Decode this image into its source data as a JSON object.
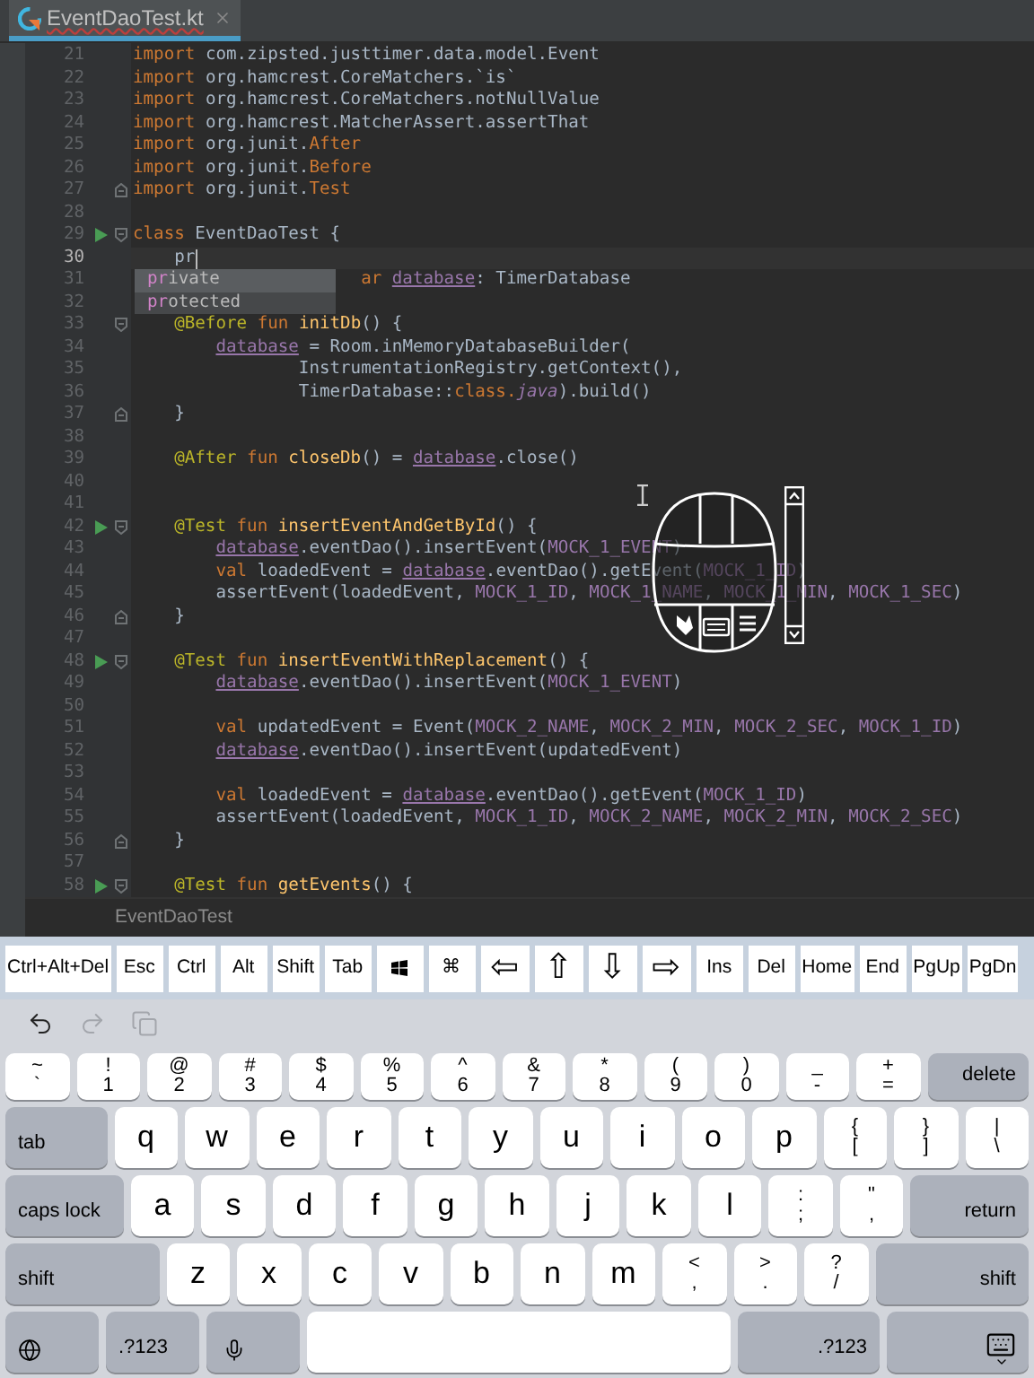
{
  "tab": {
    "label": "EventDaoTest.kt",
    "selected": true,
    "has_error": true
  },
  "editor": {
    "lines": [
      {
        "number": "21",
        "current": false,
        "tokens": [
          {
            "kind": "keyword",
            "text": "import "
          },
          {
            "kind": "plain",
            "text": "com.zipsted.justtimer.data.model.Event"
          }
        ]
      },
      {
        "number": "22",
        "current": false,
        "tokens": [
          {
            "kind": "keyword",
            "text": "import "
          },
          {
            "kind": "plain",
            "text": "org.hamcrest.CoreMatchers.`is`"
          }
        ]
      },
      {
        "number": "23",
        "current": false,
        "tokens": [
          {
            "kind": "keyword",
            "text": "import "
          },
          {
            "kind": "plain",
            "text": "org.hamcrest.CoreMatchers.notNullValue"
          }
        ]
      },
      {
        "number": "24",
        "current": false,
        "tokens": [
          {
            "kind": "keyword",
            "text": "import "
          },
          {
            "kind": "plain",
            "text": "org.hamcrest.MatcherAssert.assertThat"
          }
        ]
      },
      {
        "number": "25",
        "current": false,
        "tokens": [
          {
            "kind": "keyword",
            "text": "import "
          },
          {
            "kind": "plain",
            "text": "org.junit."
          },
          {
            "kind": "keyword",
            "text": "After"
          }
        ]
      },
      {
        "number": "26",
        "current": false,
        "tokens": [
          {
            "kind": "keyword",
            "text": "import "
          },
          {
            "kind": "plain",
            "text": "org.junit."
          },
          {
            "kind": "keyword",
            "text": "Before"
          }
        ]
      },
      {
        "number": "27",
        "current": false,
        "gutter": [
          {
            "kind": "fold_end"
          }
        ],
        "tokens": [
          {
            "kind": "keyword",
            "text": "import "
          },
          {
            "kind": "plain",
            "text": "org.junit."
          },
          {
            "kind": "keyword",
            "text": "Test"
          }
        ]
      },
      {
        "number": "28",
        "current": false
      },
      {
        "number": "29",
        "current": false,
        "gutter": [
          {
            "kind": "run"
          },
          {
            "kind": "fold_start"
          }
        ],
        "tokens": [
          {
            "kind": "keyword",
            "text": "class "
          },
          {
            "kind": "plain",
            "text": "EventDaoTest {"
          }
        ]
      },
      {
        "number": "30",
        "current": true,
        "tokens": [
          {
            "kind": "plain",
            "text": "    pr"
          }
        ]
      },
      {
        "number": "31",
        "current": false,
        "tokens": [
          {
            "kind": "keyword",
            "text": "                      ar "
          },
          {
            "kind": "property",
            "text": "database"
          },
          {
            "kind": "plain",
            "text": ": TimerDatabase"
          }
        ]
      },
      {
        "number": "32",
        "current": false
      },
      {
        "number": "33",
        "current": false,
        "gutter": [
          {
            "kind": "fold_start"
          }
        ],
        "tokens": [
          {
            "kind": "annotation",
            "text": "    @Before "
          },
          {
            "kind": "keyword",
            "text": "fun "
          },
          {
            "kind": "function",
            "text": "initDb"
          },
          {
            "kind": "plain",
            "text": "() {"
          }
        ]
      },
      {
        "number": "34",
        "current": false,
        "tokens": [
          {
            "kind": "property",
            "text": "        database"
          },
          {
            "kind": "plain",
            "text": " = Room.inMemoryDatabaseBuilder("
          }
        ]
      },
      {
        "number": "35",
        "current": false,
        "tokens": [
          {
            "kind": "plain",
            "text": "                InstrumentationRegistry.getContext(),"
          }
        ]
      },
      {
        "number": "36",
        "current": false,
        "tokens": [
          {
            "kind": "plain",
            "text": "                TimerDatabase::"
          },
          {
            "kind": "keyword",
            "text": "class."
          },
          {
            "kind": "italic",
            "text": "java"
          },
          {
            "kind": "plain",
            "text": ").build()"
          }
        ]
      },
      {
        "number": "37",
        "current": false,
        "gutter": [
          {
            "kind": "fold_end"
          }
        ],
        "tokens": [
          {
            "kind": "plain",
            "text": "    }"
          }
        ]
      },
      {
        "number": "38",
        "current": false
      },
      {
        "number": "39",
        "current": false,
        "tokens": [
          {
            "kind": "annotation",
            "text": "    @After "
          },
          {
            "kind": "keyword",
            "text": "fun "
          },
          {
            "kind": "function",
            "text": "closeDb"
          },
          {
            "kind": "plain",
            "text": "() = "
          },
          {
            "kind": "property",
            "text": "database"
          },
          {
            "kind": "plain",
            "text": ".close()"
          }
        ]
      },
      {
        "number": "40",
        "current": false
      },
      {
        "number": "41",
        "current": false
      },
      {
        "number": "42",
        "current": false,
        "gutter": [
          {
            "kind": "run"
          },
          {
            "kind": "fold_start"
          }
        ],
        "tokens": [
          {
            "kind": "annotation",
            "text": "    @Test "
          },
          {
            "kind": "keyword",
            "text": "fun "
          },
          {
            "kind": "function",
            "text": "insertEventAndGetById"
          },
          {
            "kind": "plain",
            "text": "() {"
          }
        ]
      },
      {
        "number": "43",
        "current": false,
        "tokens": [
          {
            "kind": "property",
            "text": "        database"
          },
          {
            "kind": "plain",
            "text": ".eventDao().insertEvent("
          },
          {
            "kind": "constant",
            "text": "MOCK_1_EVENT"
          },
          {
            "kind": "plain",
            "text": ")"
          }
        ]
      },
      {
        "number": "44",
        "current": false,
        "tokens": [
          {
            "kind": "keyword",
            "text": "        val "
          },
          {
            "kind": "plain",
            "text": "loadedEvent = "
          },
          {
            "kind": "property",
            "text": "database"
          },
          {
            "kind": "plain",
            "text": ".eventDao().getEvent("
          },
          {
            "kind": "constant",
            "text": "MOCK_1_ID"
          },
          {
            "kind": "plain",
            "text": ")"
          }
        ]
      },
      {
        "number": "45",
        "current": false,
        "tokens": [
          {
            "kind": "plain",
            "text": "        assertEvent(loadedEvent, "
          },
          {
            "kind": "constant",
            "text": "MOCK_1_ID"
          },
          {
            "kind": "plain",
            "text": ", "
          },
          {
            "kind": "constant",
            "text": "MOCK_1_NAME"
          },
          {
            "kind": "plain",
            "text": ", "
          },
          {
            "kind": "constant",
            "text": "MOCK_1_MIN"
          },
          {
            "kind": "plain",
            "text": ", "
          },
          {
            "kind": "constant",
            "text": "MOCK_1_SEC"
          },
          {
            "kind": "plain",
            "text": ")"
          }
        ]
      },
      {
        "number": "46",
        "current": false,
        "gutter": [
          {
            "kind": "fold_end"
          }
        ],
        "tokens": [
          {
            "kind": "plain",
            "text": "    }"
          }
        ]
      },
      {
        "number": "47",
        "current": false
      },
      {
        "number": "48",
        "current": false,
        "gutter": [
          {
            "kind": "run"
          },
          {
            "kind": "fold_start"
          }
        ],
        "tokens": [
          {
            "kind": "annotation",
            "text": "    @Test "
          },
          {
            "kind": "keyword",
            "text": "fun "
          },
          {
            "kind": "function",
            "text": "insertEventWithReplacement"
          },
          {
            "kind": "plain",
            "text": "() {"
          }
        ]
      },
      {
        "number": "49",
        "current": false,
        "tokens": [
          {
            "kind": "property",
            "text": "        database"
          },
          {
            "kind": "plain",
            "text": ".eventDao().insertEvent("
          },
          {
            "kind": "constant",
            "text": "MOCK_1_EVENT"
          },
          {
            "kind": "plain",
            "text": ")"
          }
        ]
      },
      {
        "number": "50",
        "current": false
      },
      {
        "number": "51",
        "current": false,
        "tokens": [
          {
            "kind": "keyword",
            "text": "        val "
          },
          {
            "kind": "plain",
            "text": "updatedEvent = Event("
          },
          {
            "kind": "constant",
            "text": "MOCK_2_NAME"
          },
          {
            "kind": "plain",
            "text": ", "
          },
          {
            "kind": "constant",
            "text": "MOCK_2_MIN"
          },
          {
            "kind": "plain",
            "text": ", "
          },
          {
            "kind": "constant",
            "text": "MOCK_2_SEC"
          },
          {
            "kind": "plain",
            "text": ", "
          },
          {
            "kind": "constant",
            "text": "MOCK_1_ID"
          },
          {
            "kind": "plain",
            "text": ")"
          }
        ]
      },
      {
        "number": "52",
        "current": false,
        "tokens": [
          {
            "kind": "property",
            "text": "        database"
          },
          {
            "kind": "plain",
            "text": ".eventDao().insertEvent(updatedEvent)"
          }
        ]
      },
      {
        "number": "53",
        "current": false
      },
      {
        "number": "54",
        "current": false,
        "tokens": [
          {
            "kind": "keyword",
            "text": "        val "
          },
          {
            "kind": "plain",
            "text": "loadedEvent = "
          },
          {
            "kind": "property",
            "text": "database"
          },
          {
            "kind": "plain",
            "text": ".eventDao().getEvent("
          },
          {
            "kind": "constant",
            "text": "MOCK_1_ID"
          },
          {
            "kind": "plain",
            "text": ")"
          }
        ]
      },
      {
        "number": "55",
        "current": false,
        "tokens": [
          {
            "kind": "plain",
            "text": "        assertEvent(loadedEvent, "
          },
          {
            "kind": "constant",
            "text": "MOCK_1_ID"
          },
          {
            "kind": "plain",
            "text": ", "
          },
          {
            "kind": "constant",
            "text": "MOCK_2_NAME"
          },
          {
            "kind": "plain",
            "text": ", "
          },
          {
            "kind": "constant",
            "text": "MOCK_2_MIN"
          },
          {
            "kind": "plain",
            "text": ", "
          },
          {
            "kind": "constant",
            "text": "MOCK_2_SEC"
          },
          {
            "kind": "plain",
            "text": ")"
          }
        ]
      },
      {
        "number": "56",
        "current": false,
        "gutter": [
          {
            "kind": "fold_end"
          }
        ],
        "tokens": [
          {
            "kind": "plain",
            "text": "    }"
          }
        ]
      },
      {
        "number": "57",
        "current": false
      },
      {
        "number": "58",
        "current": false,
        "gutter": [
          {
            "kind": "run"
          },
          {
            "kind": "fold_start"
          }
        ],
        "tokens": [
          {
            "kind": "annotation",
            "text": "    @Test "
          },
          {
            "kind": "keyword",
            "text": "fun "
          },
          {
            "kind": "function",
            "text": "getEvents"
          },
          {
            "kind": "plain",
            "text": "() {"
          }
        ]
      }
    ],
    "completion": [
      {
        "match": "pr",
        "rest": "ivate",
        "selected": true
      },
      {
        "match": "pr",
        "rest": "otected",
        "selected": false
      }
    ]
  },
  "breadcrumb": "EventDaoTest",
  "toolbar_keys": [
    {
      "kind": "text",
      "label": "Ctrl+Alt+Del"
    },
    {
      "kind": "text",
      "label": "Esc"
    },
    {
      "kind": "text",
      "label": "Ctrl"
    },
    {
      "kind": "text",
      "label": "Alt"
    },
    {
      "kind": "text",
      "label": "Shift"
    },
    {
      "kind": "text",
      "label": "Tab"
    },
    {
      "kind": "windows"
    },
    {
      "kind": "text",
      "label": "⌘"
    },
    {
      "kind": "arrow",
      "label": "⇦"
    },
    {
      "kind": "arrow",
      "label": "⇧"
    },
    {
      "kind": "arrow",
      "label": "⇩"
    },
    {
      "kind": "arrow",
      "label": "⇨"
    },
    {
      "kind": "text",
      "label": "Ins"
    },
    {
      "kind": "text",
      "label": "Del"
    },
    {
      "kind": "text",
      "label": "Home"
    },
    {
      "kind": "text",
      "label": "End"
    },
    {
      "kind": "text",
      "label": "PgUp"
    },
    {
      "kind": "text",
      "label": "PgDn"
    }
  ],
  "edit_actions": [
    {
      "kind": "undo",
      "disabled": false
    },
    {
      "kind": "redo",
      "disabled": true
    },
    {
      "kind": "copy",
      "disabled": true
    }
  ],
  "keyboard": [
    [
      {
        "kind": "dual",
        "top": "~",
        "label": "`"
      },
      {
        "kind": "dual",
        "top": "!",
        "label": "1"
      },
      {
        "kind": "dual",
        "top": "@",
        "label": "2"
      },
      {
        "kind": "dual",
        "top": "#",
        "label": "3"
      },
      {
        "kind": "dual",
        "top": "$",
        "label": "4"
      },
      {
        "kind": "dual",
        "top": "%",
        "label": "5"
      },
      {
        "kind": "dual",
        "top": "^",
        "label": "6"
      },
      {
        "kind": "dual",
        "top": "&",
        "label": "7"
      },
      {
        "kind": "dual",
        "top": "*",
        "label": "8"
      },
      {
        "kind": "dual",
        "top": "(",
        "label": "9"
      },
      {
        "kind": "dual",
        "top": ")",
        "label": "0"
      },
      {
        "kind": "dual",
        "top": "_",
        "label": "-"
      },
      {
        "kind": "dual",
        "top": "+",
        "label": "="
      },
      {
        "kind": "rightmod",
        "label": "delete"
      }
    ],
    [
      {
        "kind": "leftmod",
        "label": "tab"
      },
      {
        "kind": "char",
        "label": "q"
      },
      {
        "kind": "char",
        "label": "w"
      },
      {
        "kind": "char",
        "label": "e"
      },
      {
        "kind": "char",
        "label": "r"
      },
      {
        "kind": "char",
        "label": "t"
      },
      {
        "kind": "char",
        "label": "y"
      },
      {
        "kind": "char",
        "label": "u"
      },
      {
        "kind": "char",
        "label": "i"
      },
      {
        "kind": "char",
        "label": "o"
      },
      {
        "kind": "char",
        "label": "p"
      },
      {
        "kind": "dual",
        "top": "{",
        "label": "["
      },
      {
        "kind": "dual",
        "top": "}",
        "label": "]"
      },
      {
        "kind": "dual",
        "top": "|",
        "label": "\\"
      }
    ],
    [
      {
        "kind": "leftmod",
        "label": "caps lock"
      },
      {
        "kind": "char",
        "label": "a"
      },
      {
        "kind": "char",
        "label": "s"
      },
      {
        "kind": "char",
        "label": "d"
      },
      {
        "kind": "char",
        "label": "f"
      },
      {
        "kind": "char",
        "label": "g"
      },
      {
        "kind": "char",
        "label": "h"
      },
      {
        "kind": "char",
        "label": "j"
      },
      {
        "kind": "char",
        "label": "k"
      },
      {
        "kind": "char",
        "label": "l"
      },
      {
        "kind": "dual",
        "top": ":",
        "label": ";"
      },
      {
        "kind": "dual",
        "top": "\"",
        "label": ","
      },
      {
        "kind": "rightmod",
        "label": "return"
      }
    ],
    [
      {
        "kind": "leftmod",
        "label": "shift"
      },
      {
        "kind": "char",
        "label": "z"
      },
      {
        "kind": "char",
        "label": "x"
      },
      {
        "kind": "char",
        "label": "c"
      },
      {
        "kind": "char",
        "label": "v"
      },
      {
        "kind": "char",
        "label": "b"
      },
      {
        "kind": "char",
        "label": "n"
      },
      {
        "kind": "char",
        "label": "m"
      },
      {
        "kind": "dual",
        "top": "<",
        "label": ","
      },
      {
        "kind": "dual",
        "top": ">",
        "label": "."
      },
      {
        "kind": "dual",
        "top": "?",
        "label": "/"
      },
      {
        "kind": "rightmod",
        "label": "shift"
      }
    ],
    [
      {
        "kind": "globe"
      },
      {
        "kind": "leftmod",
        "label": ".?123"
      },
      {
        "kind": "mic"
      },
      {
        "kind": "space"
      },
      {
        "kind": "rightmod",
        "label": ".?123"
      },
      {
        "kind": "dismiss"
      }
    ]
  ]
}
